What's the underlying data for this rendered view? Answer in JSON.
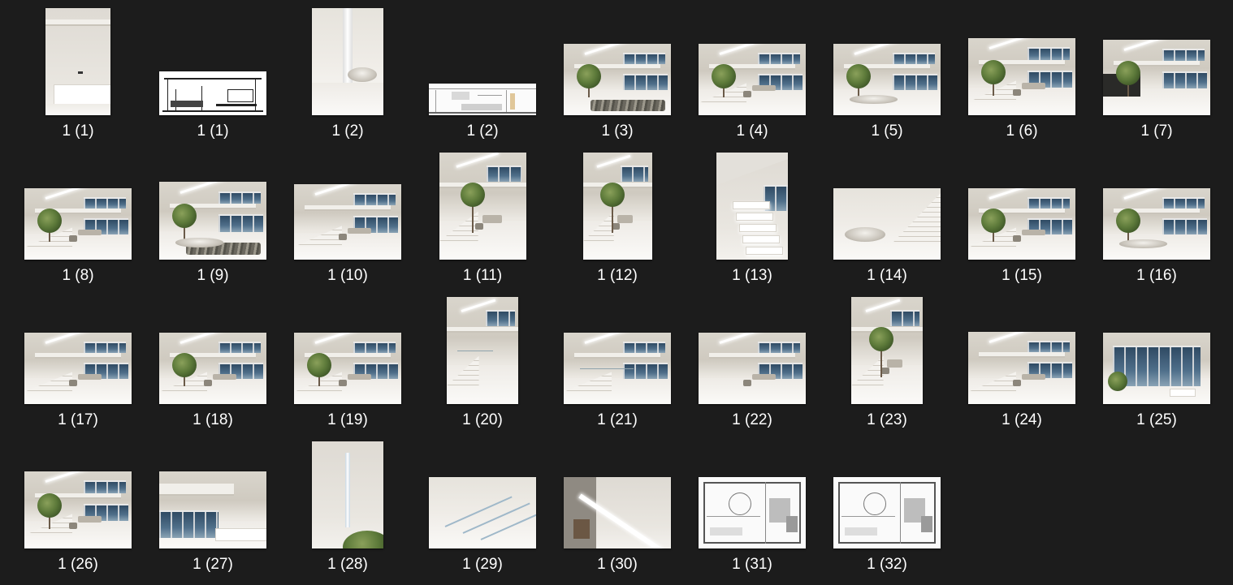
{
  "window": {
    "view": "large-icons"
  },
  "colors": {
    "background": "#1c1c1c",
    "caption_text": "#ffffff"
  },
  "files": [
    {
      "name": "1 (1)",
      "kind": "photo-portrait-lobby"
    },
    {
      "name": "1 (1)",
      "kind": "sketch-elevation"
    },
    {
      "name": "1 (2)",
      "kind": "photo-portrait-light-slot"
    },
    {
      "name": "1 (2)",
      "kind": "section-drawing"
    },
    {
      "name": "1 (3)",
      "kind": "photo-atrium-rocks"
    },
    {
      "name": "1 (4)",
      "kind": "photo-atrium-lounge"
    },
    {
      "name": "1 (5)",
      "kind": "photo-atrium-wide"
    },
    {
      "name": "1 (6)",
      "kind": "photo-atrium-tree"
    },
    {
      "name": "1 (7)",
      "kind": "photo-atrium-dark-wall"
    },
    {
      "name": "1 (8)",
      "kind": "photo-atrium-lounge"
    },
    {
      "name": "1 (9)",
      "kind": "photo-atrium-island"
    },
    {
      "name": "1 (10)",
      "kind": "photo-stairs-lounge"
    },
    {
      "name": "1 (11)",
      "kind": "photo-portrait-tree"
    },
    {
      "name": "1 (12)",
      "kind": "photo-portrait-tree"
    },
    {
      "name": "1 (13)",
      "kind": "photo-portrait-stairs"
    },
    {
      "name": "1 (14)",
      "kind": "photo-basin-stairs"
    },
    {
      "name": "1 (15)",
      "kind": "photo-atrium-tree"
    },
    {
      "name": "1 (16)",
      "kind": "photo-atrium-wide"
    },
    {
      "name": "1 (17)",
      "kind": "photo-stairs-lounge"
    },
    {
      "name": "1 (18)",
      "kind": "photo-atrium-tree"
    },
    {
      "name": "1 (19)",
      "kind": "photo-atrium-tree"
    },
    {
      "name": "1 (20)",
      "kind": "photo-portrait-glass-stairs"
    },
    {
      "name": "1 (21)",
      "kind": "photo-glass-stairs"
    },
    {
      "name": "1 (22)",
      "kind": "photo-dining"
    },
    {
      "name": "1 (23)",
      "kind": "photo-portrait-tree"
    },
    {
      "name": "1 (24)",
      "kind": "photo-stairs-lounge"
    },
    {
      "name": "1 (25)",
      "kind": "photo-glass-facade"
    },
    {
      "name": "1 (26)",
      "kind": "photo-atrium-tree"
    },
    {
      "name": "1 (27)",
      "kind": "photo-reception"
    },
    {
      "name": "1 (28)",
      "kind": "photo-portrait-wall-slit"
    },
    {
      "name": "1 (29)",
      "kind": "photo-detail-lines"
    },
    {
      "name": "1 (30)",
      "kind": "photo-detail-light"
    },
    {
      "name": "1 (31)",
      "kind": "floor-plan"
    },
    {
      "name": "1 (32)",
      "kind": "floor-plan"
    }
  ]
}
